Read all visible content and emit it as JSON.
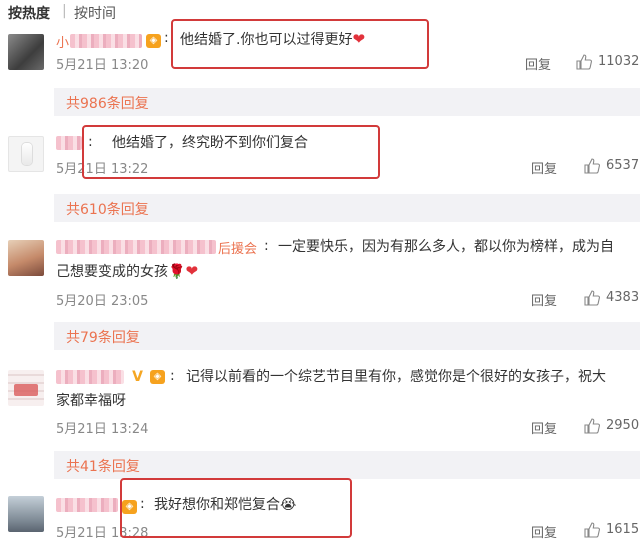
{
  "sort": {
    "hot_label": "按热度",
    "time_label": "按时间"
  },
  "comments": [
    {
      "name_prefix": "小",
      "text": "他结婚了.你也可以过得更好",
      "time": "5月21日 13:20",
      "reply_label": "回复",
      "likes": "11032",
      "replies_summary": "共986条回复"
    },
    {
      "name_prefix": "",
      "text": "他结婚了，终究盼不到你们复合",
      "time": "5月21日 13:22",
      "reply_label": "回复",
      "likes": "6537",
      "replies_summary": "共610条回复"
    },
    {
      "name_suffix": "后援会",
      "text_line1": "一定要快乐，因为有那么多人，都以你为榜样，成为自",
      "text_line2": "己想要变成的女孩",
      "time": "5月20日 23:05",
      "reply_label": "回复",
      "likes": "4383",
      "replies_summary": "共79条回复"
    },
    {
      "text_line1": "记得以前看的一个综艺节目里有你，感觉你是个很好的女孩子，祝大",
      "text_line2": "家都幸福呀",
      "time": "5月21日 13:24",
      "reply_label": "回复",
      "likes": "2950",
      "replies_summary": "共41条回复"
    },
    {
      "text": "我好想你和郑恺复合",
      "time": "5月21日 13:28",
      "reply_label": "回复",
      "likes": "1615"
    }
  ],
  "colors": {
    "accent": "#eb7350",
    "highlight_box": "#d23a3a",
    "reply_bg": "#f2f2f5"
  },
  "icons": {
    "like": "thumbs-up-icon",
    "heart": "red-heart-emoji",
    "rose": "rose-emoji",
    "crying": "crying-face-emoji"
  }
}
